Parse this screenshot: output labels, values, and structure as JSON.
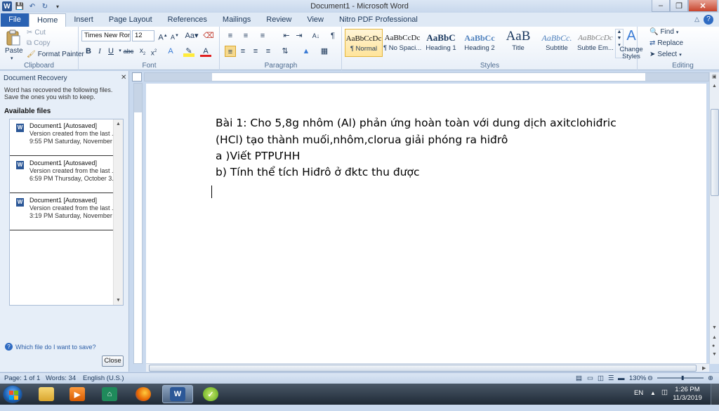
{
  "window": {
    "title": "Document1 - Microsoft Word",
    "minimize": "–",
    "restore": "❐",
    "close": "✕"
  },
  "tabs": [
    "File",
    "Home",
    "Insert",
    "Page Layout",
    "References",
    "Mailings",
    "Review",
    "View",
    "Nitro PDF Professional"
  ],
  "clipboard": {
    "paste": "Paste",
    "cut": "Cut",
    "copy": "Copy",
    "format_painter": "Format Painter",
    "label": "Clipboard"
  },
  "font": {
    "name": "Times New Rom",
    "size": "12",
    "label": "Font"
  },
  "paragraph": {
    "label": "Paragraph"
  },
  "styles": {
    "label": "Styles",
    "items": [
      {
        "preview": "AaBbCcDc",
        "name": "¶ Normal"
      },
      {
        "preview": "AaBbCcDc",
        "name": "¶ No Spaci..."
      },
      {
        "preview": "AaBbC",
        "name": "Heading 1"
      },
      {
        "preview": "AaBbCc",
        "name": "Heading 2"
      },
      {
        "preview": "AaB",
        "name": "Title"
      },
      {
        "preview": "AaBbCc.",
        "name": "Subtitle"
      },
      {
        "preview": "AaBbCcDc",
        "name": "Subtle Em..."
      }
    ],
    "change_styles": "Change Styles"
  },
  "editing": {
    "find": "Find",
    "replace": "Replace",
    "select": "Select",
    "label": "Editing"
  },
  "recovery": {
    "title": "Document Recovery",
    "description": "Word has recovered the following files.  Save the ones you wish to keep.",
    "available": "Available files",
    "files": [
      {
        "name": "Document1  [Autosaved]",
        "line2": "Version created from the last ...",
        "line3": "9:55 PM Saturday, November ..."
      },
      {
        "name": "Document1  [Autosaved]",
        "line2": "Version created from the last ...",
        "line3": "6:59 PM Thursday, October 3..."
      },
      {
        "name": "Document1  [Autosaved]",
        "line2": "Version created from the last ...",
        "line3": "3:19 PM Saturday, November ..."
      }
    ],
    "help_link": "Which file do I want to save?",
    "close_button": "Close"
  },
  "document": {
    "lines": [
      "Bài 1: Cho 5,8g nhôm (Al) phản ứng hoàn toàn với dung dịch axitclohiđric",
      "(HCl) tạo thành muối,nhôm,clorua giải phóng ra hiđrô",
      "a )Viết PTPƯHH",
      "b) Tính thể tích Hiđrô ở đktc thu được"
    ]
  },
  "status": {
    "page": "Page: 1 of 1",
    "words": "Words: 34",
    "language": "English (U.S.)",
    "zoom": "130%"
  },
  "taskbar": {
    "language": "EN",
    "time": "1:26 PM",
    "date": "11/3/2019"
  },
  "colors": {
    "file_tab": "#2a62b3",
    "ribbon_bg": "#e8eff8",
    "taskbar": "#1f2a36",
    "word_blue": "#2b5797"
  }
}
